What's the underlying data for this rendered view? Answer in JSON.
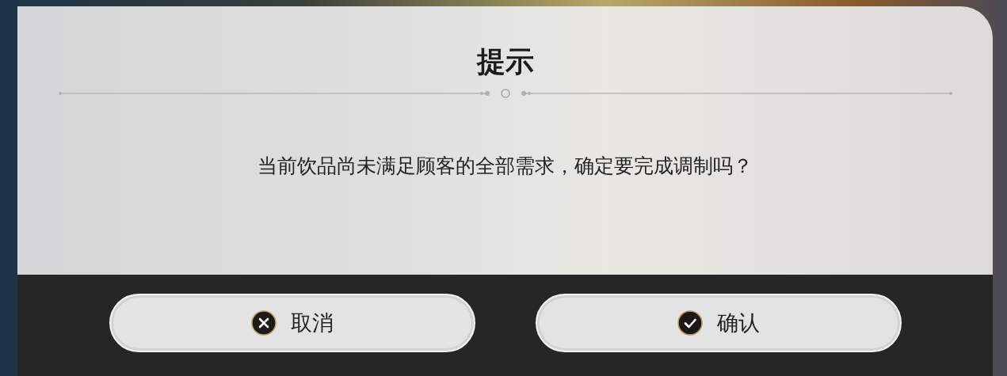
{
  "dialog": {
    "title": "提示",
    "message": "当前饮品尚未满足顾客的全部需求，确定要完成调制吗？",
    "buttons": [
      {
        "kind": "cancel",
        "label": "取消"
      },
      {
        "kind": "confirm",
        "label": "确认"
      }
    ]
  }
}
